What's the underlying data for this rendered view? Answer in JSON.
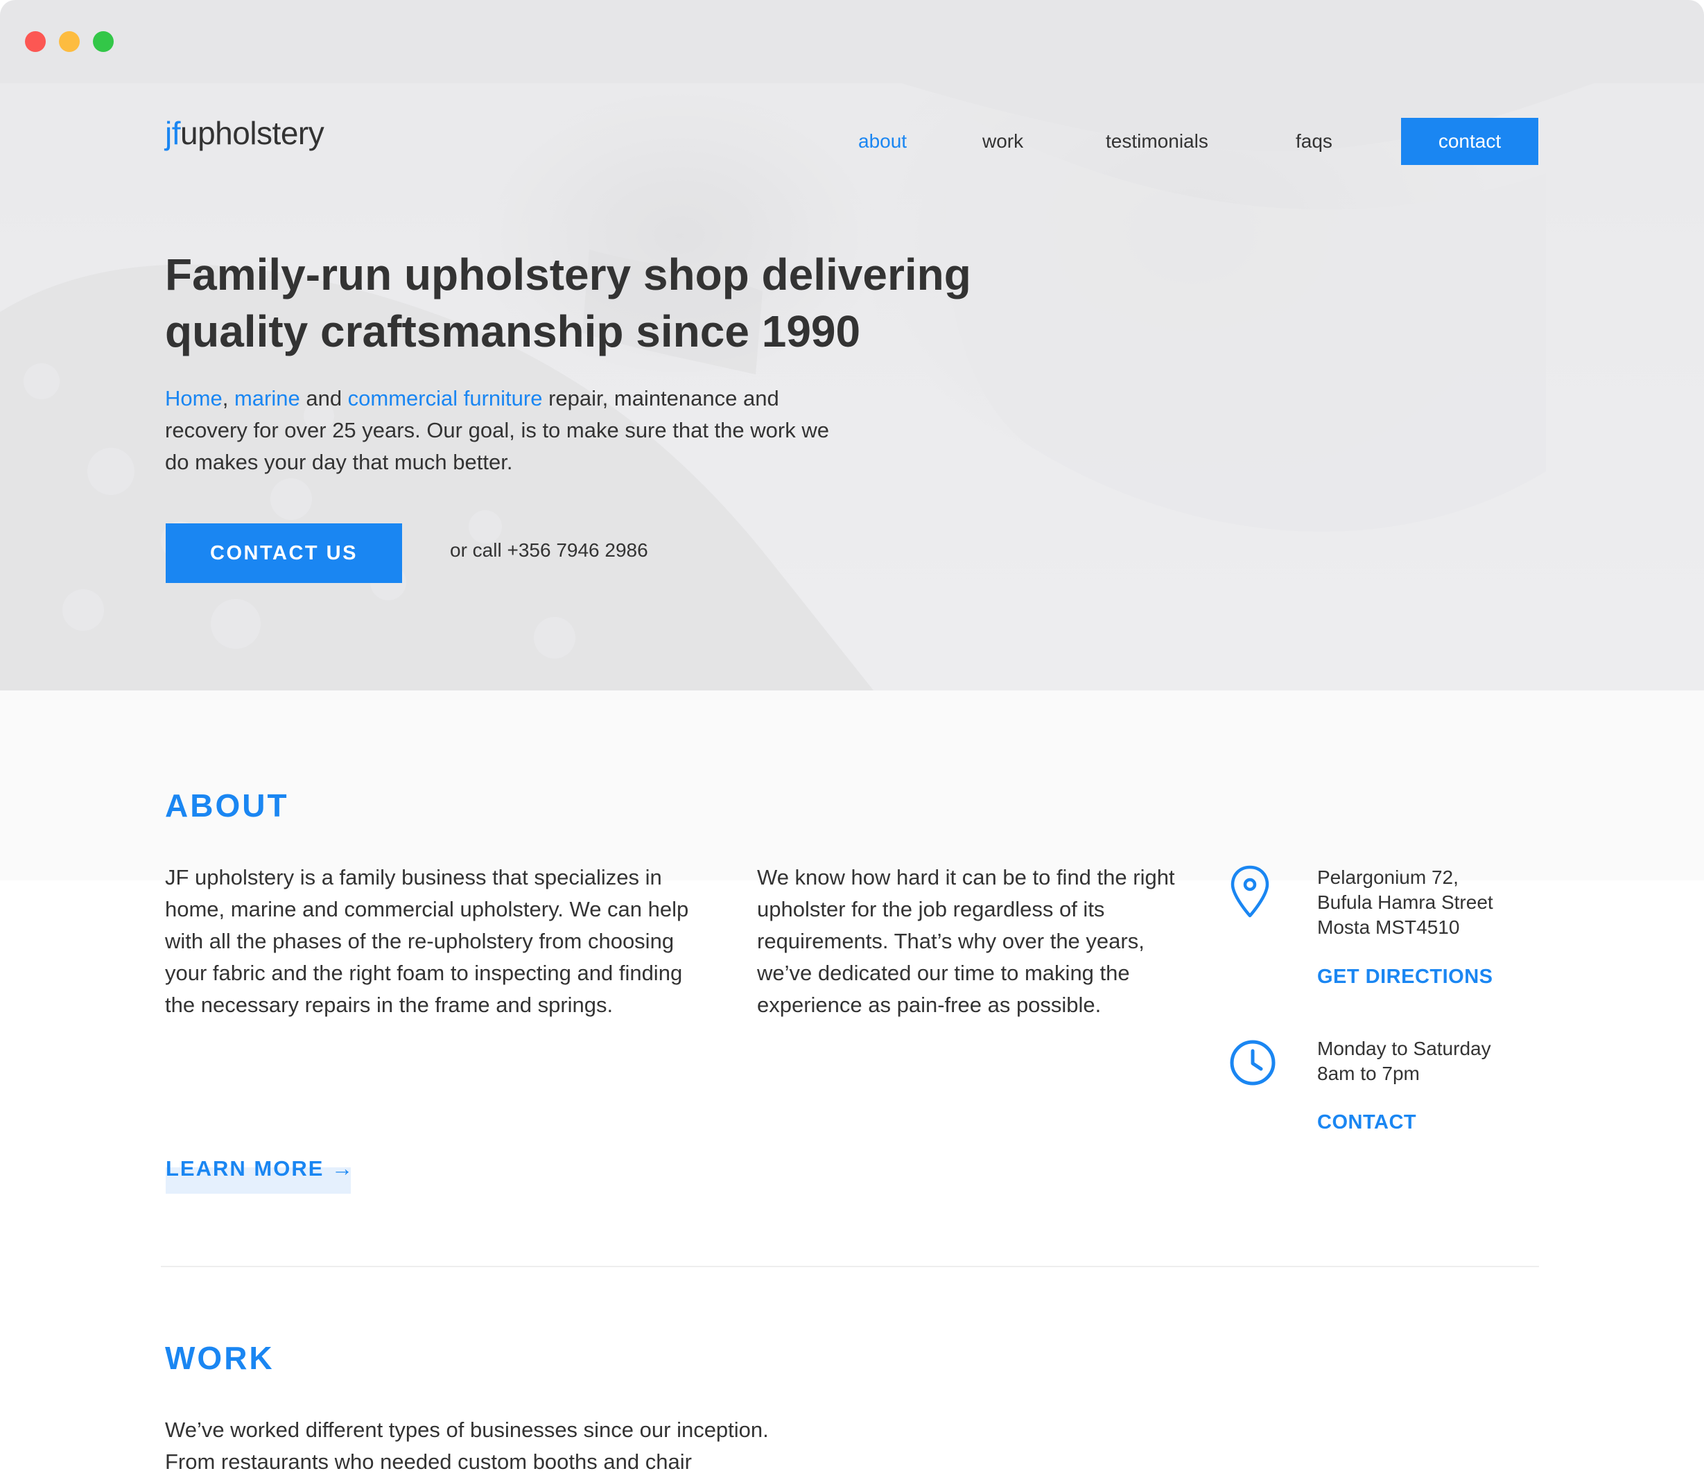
{
  "window": {
    "buttons": [
      "close",
      "minimize",
      "maximize"
    ]
  },
  "logo": {
    "mark": "jf",
    "text": "upholstery"
  },
  "nav": {
    "items": [
      {
        "label": "about",
        "active": true
      },
      {
        "label": "work",
        "active": false
      },
      {
        "label": "testimonials",
        "active": false
      },
      {
        "label": "faqs",
        "active": false
      }
    ],
    "contact_label": "contact"
  },
  "hero": {
    "headline_line1": "Family-run upholstery shop delivering",
    "headline_line2": "quality craftsmanship since 1990",
    "link_home": "Home",
    "comma": ",",
    "link_marine": "marine",
    "and": " and ",
    "link_commercial": "commercial furniture",
    "para_rest": " repair, maintenance and recovery for over 25 years. Our goal, is to make sure that the work we do makes your day that much better.",
    "cta_label": "CONTACT US",
    "call_text": "or call +356 7946 2986"
  },
  "about": {
    "title": "ABOUT",
    "col1": "JF upholstery is a family business that specializes in home, marine and commercial upholstery. We can help with all the phases of the re-upholstery from choosing your fabric and the right foam to inspecting and finding the necessary repairs in the frame and springs.",
    "col2": "We know how hard it can be to find the right upholster for the job regardless of its requirements. That’s why over the years, we’ve dedicated our time to making the experience as pain-free as possible.",
    "address_line1": "Pelargonium 72,",
    "address_line2": "Bufula Hamra Street",
    "address_line3": "Mosta MST4510",
    "directions_label": "GET DIRECTIONS",
    "hours_line1": "Monday to Saturday",
    "hours_line2": "8am to 7pm",
    "contact_label": "CONTACT",
    "learn_more_label": "LEARN MORE →",
    "icons": [
      "map-pin-icon",
      "clock-icon"
    ]
  },
  "work": {
    "title": "WORK",
    "para_line1": "We’ve worked different types of businesses since our inception.",
    "para_line2": "From restaurants who needed custom booths and chair"
  },
  "colors": {
    "accent": "#1a86f2",
    "text": "#333333",
    "chrome": "#e6e6e8"
  }
}
